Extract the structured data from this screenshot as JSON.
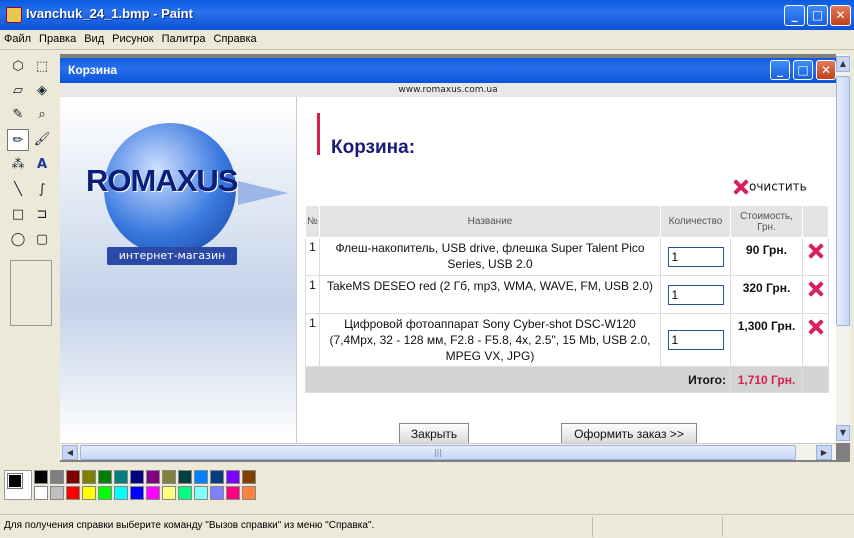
{
  "window": {
    "title": "Ivanchuk_24_1.bmp - Paint",
    "minimize_glyph": "_",
    "maximize_glyph": "□",
    "close_glyph": "✕"
  },
  "menu": [
    "Файл",
    "Правка",
    "Вид",
    "Рисунок",
    "Палитра",
    "Справка"
  ],
  "tools": [
    {
      "icon": "free-select-icon",
      "glyph": "⬡"
    },
    {
      "icon": "rect-select-icon",
      "glyph": "⬚"
    },
    {
      "icon": "eraser-icon",
      "glyph": "▱"
    },
    {
      "icon": "fill-bucket-icon",
      "glyph": "◈"
    },
    {
      "icon": "color-picker-icon",
      "glyph": "✎"
    },
    {
      "icon": "magnifier-icon",
      "glyph": "⌕"
    },
    {
      "icon": "pencil-icon",
      "glyph": "✏"
    },
    {
      "icon": "brush-icon",
      "glyph": "🖌"
    },
    {
      "icon": "airbrush-icon",
      "glyph": "⁂"
    },
    {
      "icon": "text-icon",
      "glyph": "A"
    },
    {
      "icon": "line-icon",
      "glyph": "╲"
    },
    {
      "icon": "curve-icon",
      "glyph": "∫"
    },
    {
      "icon": "rectangle-icon",
      "glyph": "□"
    },
    {
      "icon": "polygon-icon",
      "glyph": "⊐"
    },
    {
      "icon": "ellipse-icon",
      "glyph": "◯"
    },
    {
      "icon": "rounded-rect-icon",
      "glyph": "▢"
    }
  ],
  "inner_window": {
    "title": "Корзина"
  },
  "webpage": {
    "url": "www.romaxus.com.ua",
    "logo_text": "ROMAXUS",
    "tagline": "интернет-магазин",
    "heading": "Корзина:",
    "clear_label": "очистить",
    "columns": {
      "num": "№",
      "name": "Название",
      "qty": "Количество",
      "price": "Стоимость, Грн."
    },
    "items": [
      {
        "num": "1",
        "name": "Флеш-накопитель, USB drive, флешка Super Talent Pico Series, USB 2.0",
        "qty": "1",
        "price": "90 Грн."
      },
      {
        "num": "1",
        "name": "TakeMS DESEO red (2 Гб, mp3, WMA, WAVE, FM, USB 2.0)",
        "qty": "1",
        "price": "320 Грн."
      },
      {
        "num": "1",
        "name": "Цифровой фотоаппарат Sony Cyber-shot DSC-W120 (7,4Mpx, 32 - 128 мм, F2.8 - F5.8, 4x, 2.5\", 15 Mb, USB 2.0, MPEG VX, JPG)",
        "qty": "1",
        "price": "1,300 Грн."
      }
    ],
    "total_label": "Итого:",
    "total_value": "1,710 Грн.",
    "close_button": "Закрыть",
    "order_button": "Оформить заказ >>"
  },
  "scroll": {
    "left": "◀",
    "right": "▶",
    "up": "▲",
    "down": "▼",
    "grip": "|||"
  },
  "palette": {
    "top": [
      "#000000",
      "#808080",
      "#800000",
      "#808000",
      "#008000",
      "#008080",
      "#000080",
      "#800080",
      "#808040",
      "#004040",
      "#0080ff",
      "#004080",
      "#8000ff",
      "#804000"
    ],
    "bottom": [
      "#ffffff",
      "#c0c0c0",
      "#ff0000",
      "#ffff00",
      "#00ff00",
      "#00ffff",
      "#0000ff",
      "#ff00ff",
      "#ffff80",
      "#00ff80",
      "#80ffff",
      "#8080ff",
      "#ff0080",
      "#ff8040"
    ]
  },
  "status": {
    "text": "Для получения справки выберите команду \"Вызов справки\" из меню \"Справка\"."
  },
  "colors": {
    "accent": "#d8204e",
    "heading": "#1a1a7a",
    "titlebar": "#0b53d8"
  }
}
